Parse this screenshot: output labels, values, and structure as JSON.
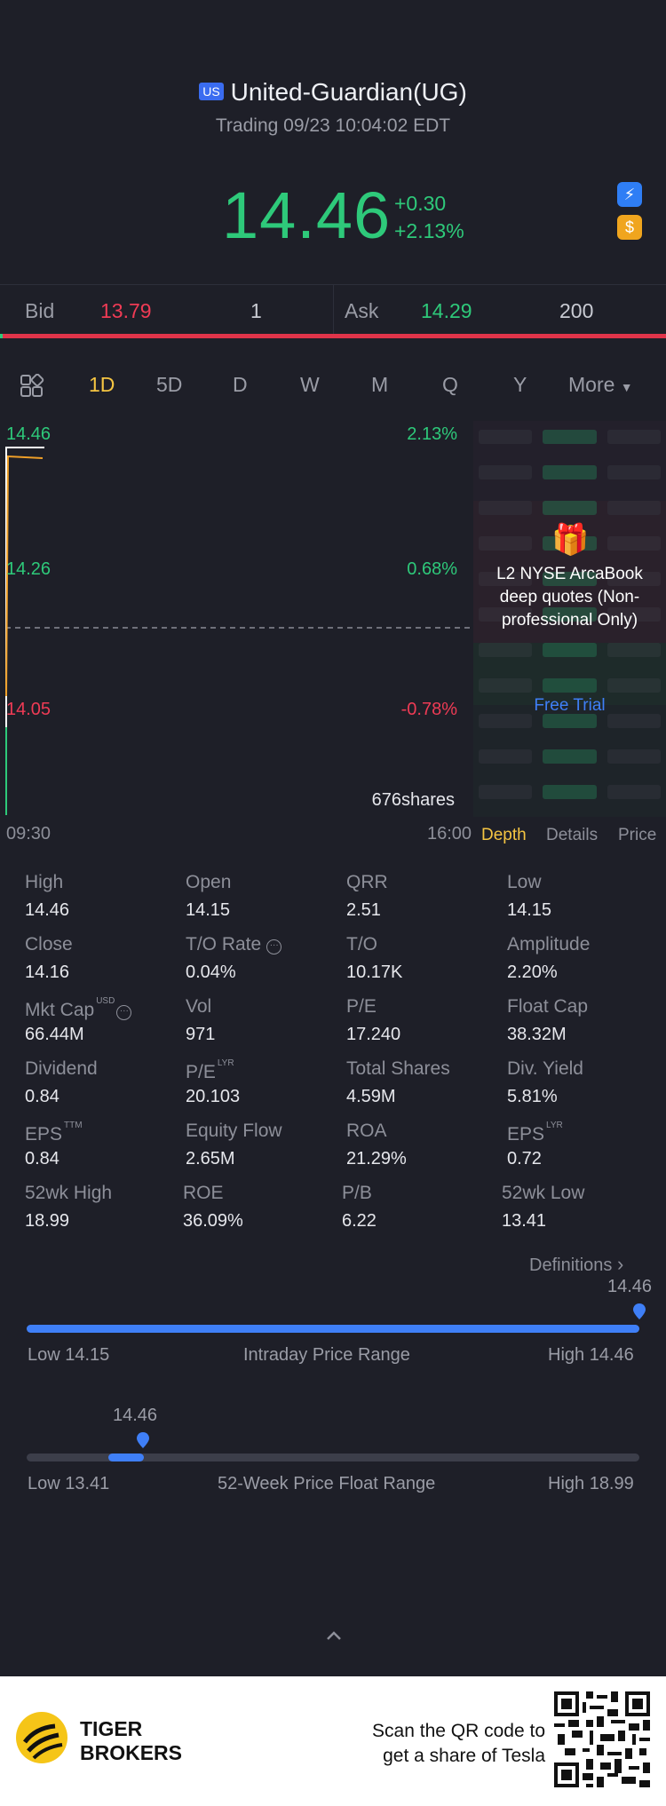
{
  "header": {
    "market_badge": "US",
    "title": "United-Guardian(UG)",
    "subtitle": "Trading 09/23 10:04:02 EDT"
  },
  "quote": {
    "price": "14.46",
    "change": "+0.30",
    "change_pct": "+2.13%",
    "icons": [
      "lightning-1-icon",
      "dollar-icon"
    ]
  },
  "bid_ask": {
    "bid_label": "Bid",
    "bid_price": "13.79",
    "bid_size": "1",
    "ask_label": "Ask",
    "ask_price": "14.29",
    "ask_size": "200"
  },
  "tabs": {
    "grid_icon": "grid-icon",
    "items": [
      "1D",
      "5D",
      "D",
      "W",
      "M",
      "Q",
      "Y"
    ],
    "active": "1D",
    "more": "More"
  },
  "chart": {
    "price_labels": [
      "14.46",
      "14.26",
      "14.05"
    ],
    "pct_labels": [
      "2.13%",
      "0.68%",
      "-0.78%"
    ],
    "volume": "676shares",
    "time_start": "09:30",
    "time_end": "16:00",
    "colors": {
      "up": "#2ec97a",
      "down": "#ef3b55",
      "avg": "#f0a028",
      "price_line": "#ffffff"
    }
  },
  "l2": {
    "title": "L2 NYSE ArcaBook deep quotes (Non-professional Only)",
    "cta": "Free Trial"
  },
  "panel_tabs": {
    "depth": "Depth",
    "details": "Details",
    "price": "Price"
  },
  "stats": [
    [
      {
        "label": "High",
        "value": "14.46"
      },
      {
        "label": "Open",
        "value": "14.15"
      },
      {
        "label": "QRR",
        "value": "2.51"
      },
      {
        "label": "Low",
        "value": "14.15"
      }
    ],
    [
      {
        "label": "Close",
        "value": "14.16"
      },
      {
        "label": "T/O Rate",
        "value": "0.04%"
      },
      {
        "label": "T/O",
        "value": "10.17K"
      },
      {
        "label": "Amplitude",
        "value": "2.20%"
      }
    ],
    [
      {
        "label": "Mkt Cap",
        "value": "66.44M"
      },
      {
        "label": "Vol",
        "value": "971"
      },
      {
        "label": "P/E",
        "value": "17.240"
      },
      {
        "label": "Float Cap",
        "value": "38.32M"
      }
    ],
    [
      {
        "label": "Dividend",
        "value": "0.84"
      },
      {
        "label": "P/E",
        "value": "20.103"
      },
      {
        "label": "Total Shares",
        "value": "4.59M"
      },
      {
        "label": "Div. Yield",
        "value": "5.81%"
      }
    ],
    [
      {
        "label": "EPS",
        "value": "0.84"
      },
      {
        "label": "Equity Flow",
        "value": "2.65M"
      },
      {
        "label": "ROA",
        "value": "21.29%"
      },
      {
        "label": "EPS",
        "value": "0.72"
      }
    ],
    [
      {
        "label": "52wk High",
        "value": "18.99"
      },
      {
        "label": "ROE",
        "value": "36.09%"
      },
      {
        "label": "P/B",
        "value": "6.22"
      },
      {
        "label": "52wk Low",
        "value": "13.41"
      }
    ]
  ],
  "stat_sups": {
    "usd": "USD",
    "lyr": "LYR",
    "ttm": "TTM"
  },
  "definitions": "Definitions",
  "intraday_range": {
    "current": "14.46",
    "low": "Low 14.15",
    "title": "Intraday Price Range",
    "high": "High 14.46",
    "position": 1.0
  },
  "week52_range": {
    "current": "14.46",
    "low": "Low 13.41",
    "title": "52-Week Price Float Range",
    "high": "High 18.99",
    "position": 0.19
  },
  "footer": {
    "brand_line1": "TIGER",
    "brand_line2": "BROKERS",
    "promo_line1": "Scan the QR code to",
    "promo_line2": "get a share of Tesla"
  }
}
